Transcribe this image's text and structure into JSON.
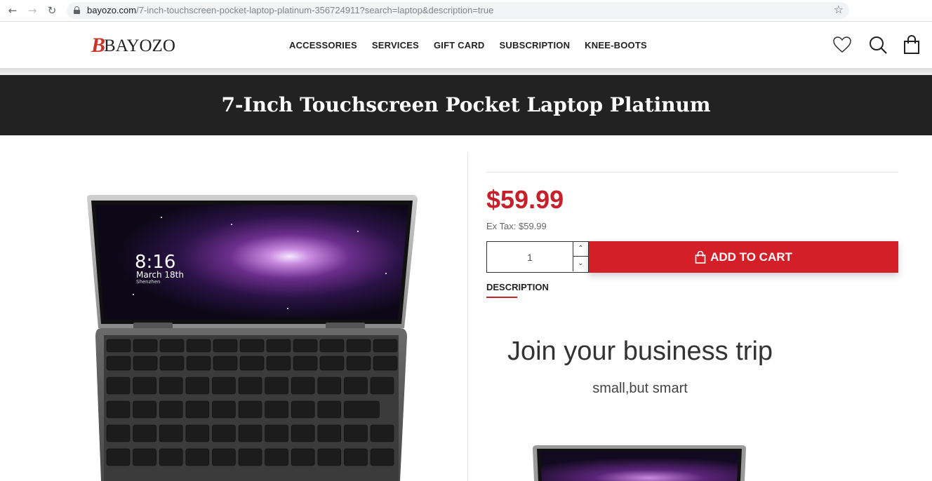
{
  "browser": {
    "url_host": "bayozo.com",
    "url_path": "/7-inch-touchscreen-pocket-laptop-platinum-356724911?search=laptop&description=true"
  },
  "header": {
    "logo_mark": "B",
    "logo_text": "BAYOZO",
    "nav": [
      "ACCESSORIES",
      "SERVICES",
      "GIFT CARD",
      "SUBSCRIPTION",
      "KNEE-BOOTS"
    ]
  },
  "product": {
    "title": "7-Inch Touchscreen Pocket Laptop Platinum",
    "price": "$59.99",
    "ex_tax": "Ex Tax: $59.99",
    "quantity": "1",
    "add_to_cart": "ADD TO CART",
    "description_tab": "DESCRIPTION",
    "screen_time": "8:16",
    "screen_date": "March 18th",
    "screen_city": "Shenzhen"
  },
  "promo": {
    "heading": "Join your business trip",
    "subheading": "small,but smart"
  },
  "colors": {
    "accent": "#d41f28",
    "dark_band": "#222222"
  }
}
